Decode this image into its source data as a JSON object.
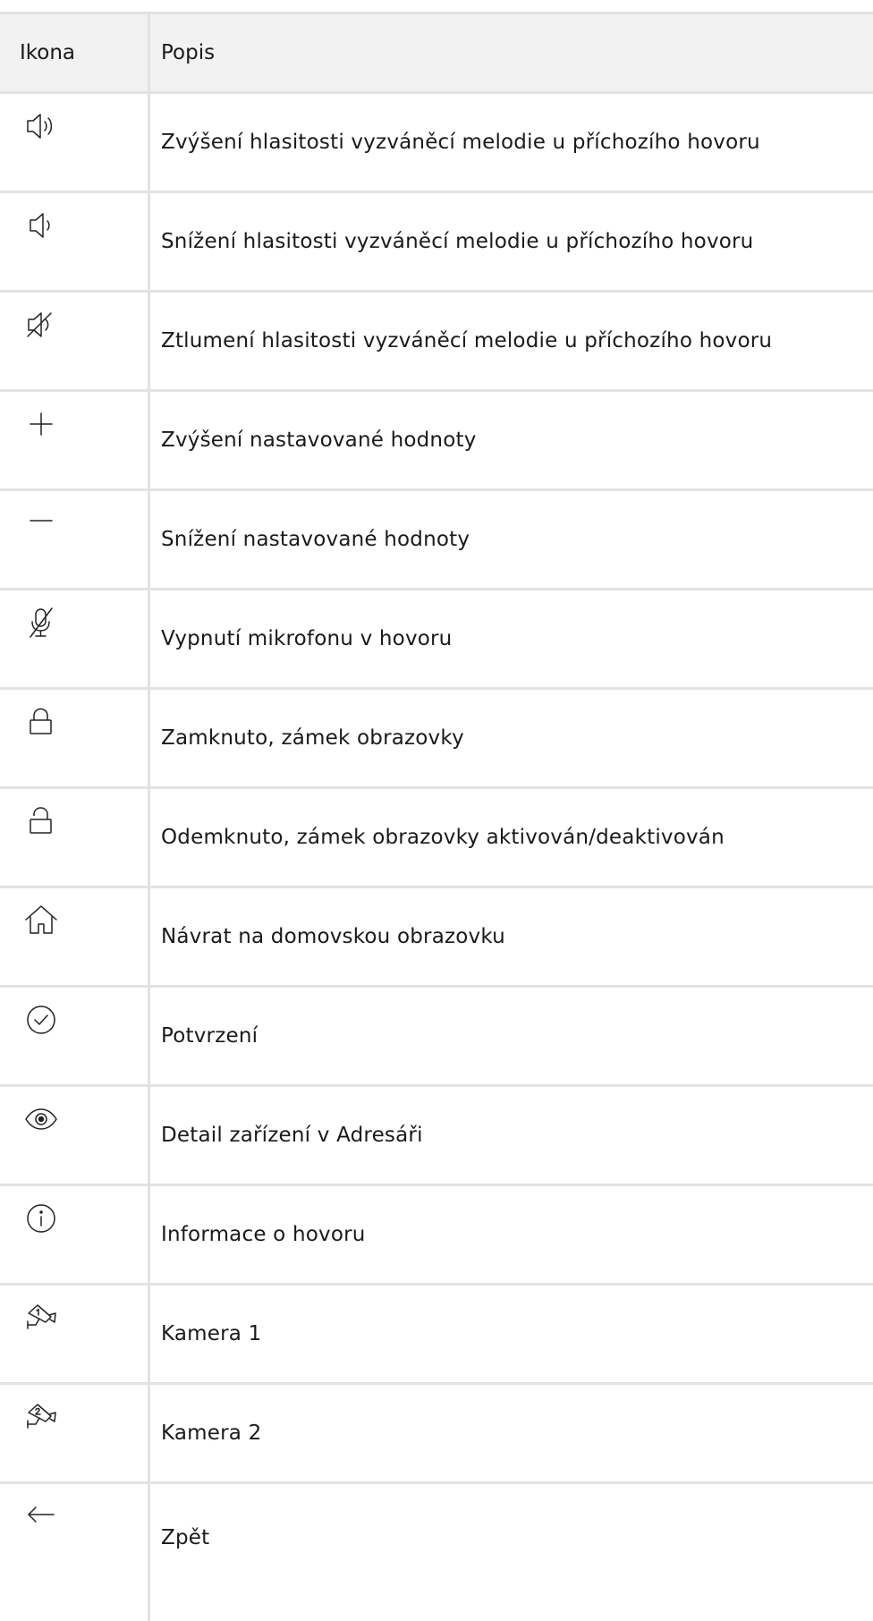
{
  "header": {
    "col_icon": "Ikona",
    "col_desc": "Popis"
  },
  "rows": [
    {
      "icon": "volume-up-icon",
      "desc": "Zvýšení hlasitosti vyzváněcí melodie u příchozího hovoru"
    },
    {
      "icon": "volume-down-icon",
      "desc": "Snížení hlasitosti vyzváněcí melodie u příchozího hovoru"
    },
    {
      "icon": "volume-mute-icon",
      "desc": "Ztlumení hlasitosti vyzváněcí melodie u příchozího hovoru"
    },
    {
      "icon": "plus-icon",
      "desc": "Zvýšení nastavované hodnoty"
    },
    {
      "icon": "minus-icon",
      "desc": "Snížení nastavované hodnoty"
    },
    {
      "icon": "microphone-off-icon",
      "desc": "Vypnutí mikrofonu v hovoru"
    },
    {
      "icon": "lock-icon",
      "desc": "Zamknuto, zámek obrazovky"
    },
    {
      "icon": "unlock-icon",
      "desc": "Odemknuto, zámek obrazovky aktivován/deaktivován"
    },
    {
      "icon": "home-icon",
      "desc": "Návrat na domovskou obrazovku"
    },
    {
      "icon": "check-circle-icon",
      "desc": "Potvrzení"
    },
    {
      "icon": "eye-icon",
      "desc": "Detail zařízení v Adresáři"
    },
    {
      "icon": "info-icon",
      "desc": "Informace o hovoru"
    },
    {
      "icon": "camera-1-icon",
      "desc": "Kamera 1"
    },
    {
      "icon": "camera-2-icon",
      "desc": "Kamera 2"
    },
    {
      "icon": "arrow-left-icon",
      "desc": "Zpět"
    }
  ]
}
